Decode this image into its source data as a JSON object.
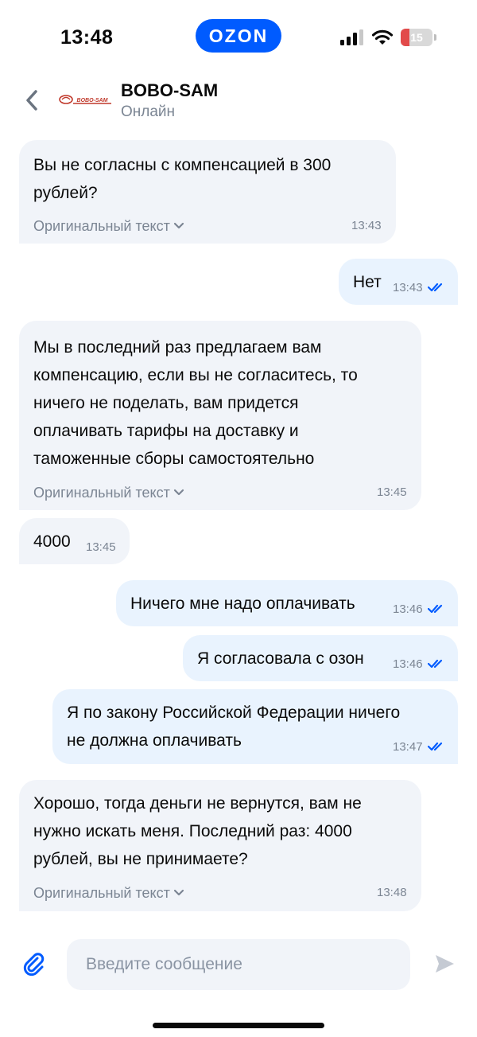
{
  "status_bar": {
    "time": "13:48",
    "brand": "OZON",
    "battery": "15"
  },
  "header": {
    "logo_text": "BOBO-SAM",
    "title": "BOBO-SAM",
    "status": "Онлайн"
  },
  "messages": [
    {
      "dir": "in",
      "text": "Вы не согласны с компенсацией в 300\nрублей?",
      "original_link": "Оригинальный текст",
      "time": "13:43"
    },
    {
      "dir": "out",
      "text": "Нет",
      "time": "13:43",
      "read": true
    },
    {
      "dir": "in",
      "text": "Мы в последний раз предлагаем вам\nкомпенсацию, если вы не согласитесь, то\nничего не поделать, вам придется\nоплачивать тарифы на доставку и\nтаможенные сборы самостоятельно",
      "original_link": "Оригинальный текст",
      "time": "13:45"
    },
    {
      "dir": "in",
      "text": "4000",
      "time": "13:45"
    },
    {
      "dir": "out",
      "text": "Ничего мне надо оплачивать",
      "time": "13:46",
      "read": true
    },
    {
      "dir": "out",
      "text": "Я согласовала с озон",
      "time": "13:46",
      "read": true
    },
    {
      "dir": "out",
      "text": "Я по закону Российской Федерации ничего\nне должна оплачивать",
      "time": "13:47",
      "read": true
    },
    {
      "dir": "in",
      "text": "Хорошо, тогда деньги не вернутся, вам не\nнужно искать меня. Последний раз: 4000\nрублей, вы не принимаете?",
      "original_link": "Оригинальный текст",
      "time": "13:48"
    }
  ],
  "composer": {
    "placeholder": "Введите сообщение"
  },
  "colors": {
    "accent": "#005bff",
    "incoming_bubble": "#f1f4f9",
    "outgoing_bubble": "#e9f3fe",
    "read_tick": "#005bff",
    "muted_text": "#7b8593"
  }
}
